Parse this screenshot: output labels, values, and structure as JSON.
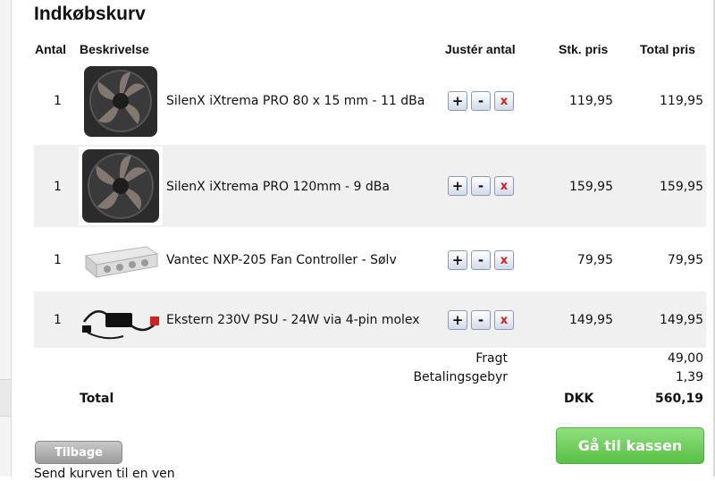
{
  "cart": {
    "title": "Indkøbskurv",
    "headers": {
      "qty": "Antal",
      "description": "Beskrivelse",
      "adjust": "Justér antal",
      "unit_price": "Stk. pris",
      "total_price": "Total pris"
    },
    "buttons": {
      "plus": "+",
      "minus": "-",
      "remove": "x"
    },
    "items": [
      {
        "qty": "1",
        "description": "SilenX iXtrema PRO 80 x 15 mm - 11 dBa",
        "unit_price": "119,95",
        "total_price": "119,95",
        "image": "fan-80mm-image"
      },
      {
        "qty": "1",
        "description": "SilenX iXtrema PRO 120mm - 9 dBa",
        "unit_price": "159,95",
        "total_price": "159,95",
        "image": "fan-120mm-image"
      },
      {
        "qty": "1",
        "description": "Vantec NXP-205 Fan Controller - Sølv",
        "unit_price": "79,95",
        "total_price": "79,95",
        "image": "fan-controller-image"
      },
      {
        "qty": "1",
        "description": "Ekstern 230V PSU - 24W via 4-pin molex",
        "unit_price": "149,95",
        "total_price": "149,95",
        "image": "power-supply-image"
      }
    ],
    "summary": {
      "shipping_label": "Fragt",
      "shipping_value": "49,00",
      "fee_label": "Betalingsgebyr",
      "fee_value": "1,39",
      "total_label": "Total",
      "currency": "DKK",
      "total_value": "560,19"
    },
    "actions": {
      "back": "Tilbage",
      "checkout": "Gå til kassen",
      "send": "Send kurven til en ven"
    }
  },
  "colors": {
    "checkout_green": "#58bf45",
    "row_alt": "#f0f0f0",
    "remove_red": "#cc2222"
  }
}
